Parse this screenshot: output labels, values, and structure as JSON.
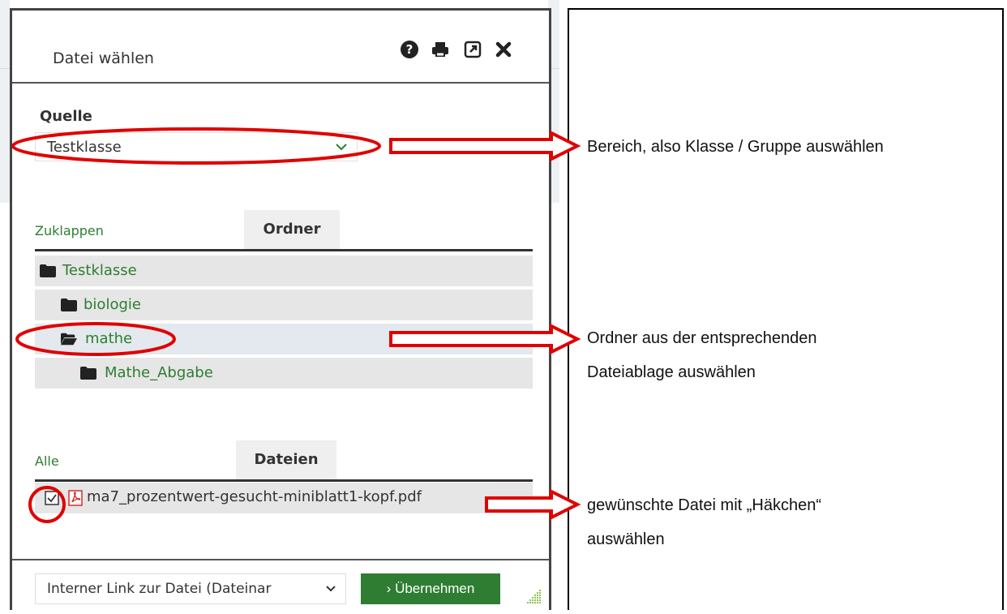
{
  "dialog": {
    "title": "Datei wählen",
    "header_icons": [
      "help-icon",
      "print-icon",
      "popout-icon",
      "close-icon"
    ]
  },
  "source": {
    "label": "Quelle",
    "selected": "Testklasse"
  },
  "folders": {
    "collapse_link": "Zuklappen",
    "tab_label": "Ordner",
    "items": [
      {
        "label": "Testklasse",
        "level": 0,
        "state": "closed"
      },
      {
        "label": "biologie",
        "level": 1,
        "state": "closed"
      },
      {
        "label": "mathe",
        "level": 1,
        "state": "open",
        "selected": true
      },
      {
        "label": "Mathe_Abgabe",
        "level": 2,
        "state": "closed"
      }
    ]
  },
  "files": {
    "all_link": "Alle",
    "tab_label": "Dateien",
    "items": [
      {
        "name": "ma7_prozentwert-gesucht-miniblatt1-kopf.pdf",
        "checked": true
      }
    ]
  },
  "footer": {
    "link_type_selected": "Interner Link zur Datei (Dateinar",
    "apply_label": "Übernehmen",
    "apply_prefix": "›"
  },
  "annotations": {
    "source": "Bereich, also Klasse / Gruppe auswählen",
    "folder_line1": "Ordner aus der entsprechenden",
    "folder_line2": "Dateiablage auswählen",
    "file_line1": "gewünschte Datei mit „Häkchen“",
    "file_line2": "auswählen"
  },
  "colors": {
    "accent": "#2e7d32",
    "highlight": "#e00000"
  }
}
